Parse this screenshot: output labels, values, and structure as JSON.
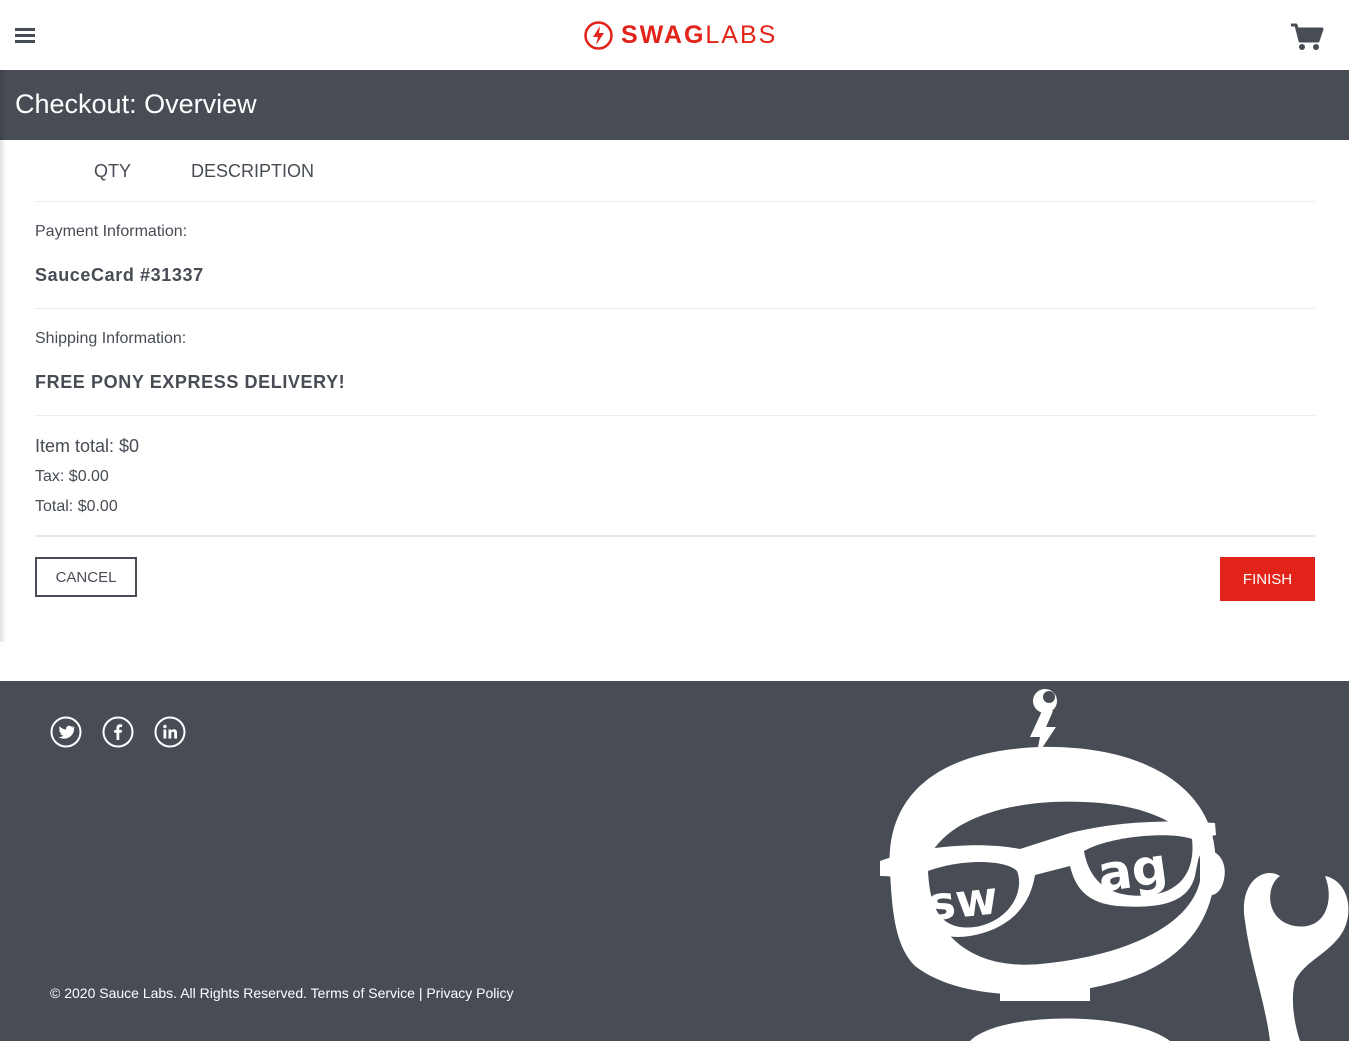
{
  "header": {
    "logo": {
      "strong": "SWAG",
      "light": "LABS"
    },
    "menu_icon": "hamburger-menu-icon",
    "cart_icon": "shopping-cart-icon"
  },
  "page": {
    "title": "Checkout: Overview"
  },
  "cart_list": {
    "headers": {
      "qty": "QTY",
      "description": "DESCRIPTION"
    }
  },
  "summary": {
    "payment_label": "Payment Information:",
    "payment_value": "SauceCard #31337",
    "shipping_label": "Shipping Information:",
    "shipping_value": "FREE PONY EXPRESS DELIVERY!",
    "item_total": "Item total: $0",
    "tax": "Tax: $0.00",
    "total": "Total: $0.00"
  },
  "actions": {
    "cancel": "CANCEL",
    "finish": "FINISH"
  },
  "footer": {
    "social": [
      "twitter-icon",
      "facebook-icon",
      "linkedin-icon"
    ],
    "copyright": "© 2020 Sauce Labs. All Rights Reserved.",
    "terms": "Terms of Service",
    "separator": "|",
    "privacy": "Privacy Policy",
    "robot_text": "swag"
  },
  "colors": {
    "brand_red": "#e2231a",
    "dark_gray": "#474c55",
    "white": "#ffffff"
  }
}
